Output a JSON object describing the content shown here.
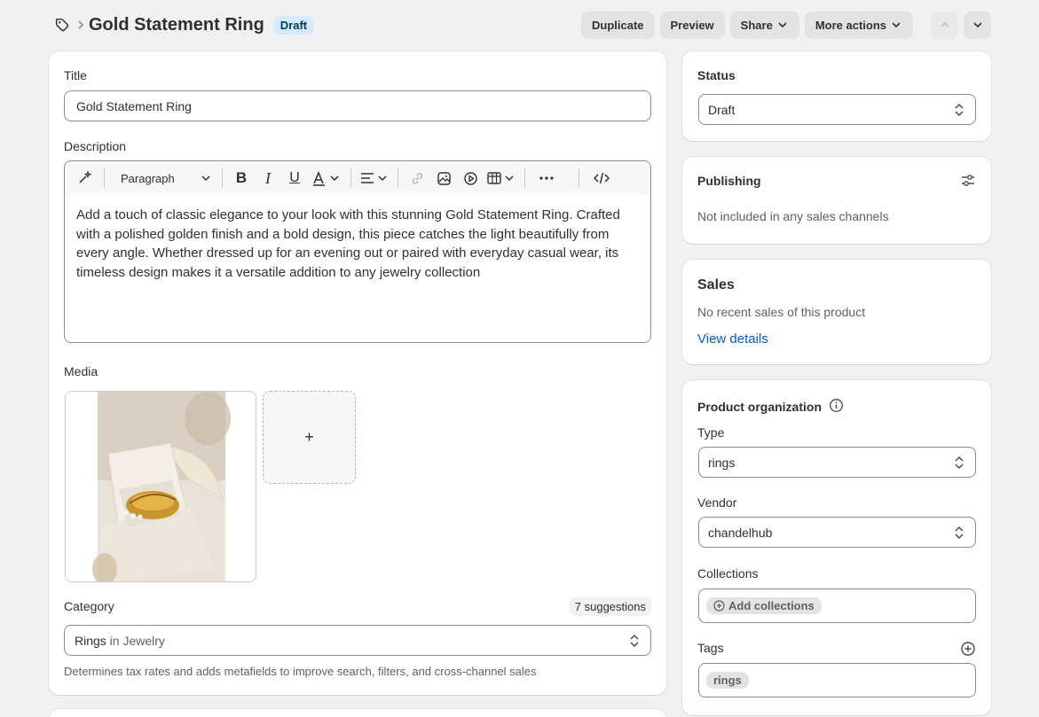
{
  "header": {
    "title": "Gold Statement Ring",
    "status_badge": "Draft",
    "actions": {
      "duplicate": "Duplicate",
      "preview": "Preview",
      "share": "Share",
      "more": "More actions"
    }
  },
  "main": {
    "title_label": "Title",
    "title_value": "Gold Statement Ring",
    "description_label": "Description",
    "toolbar_paragraph": "Paragraph",
    "description_text": "Add a touch of classic elegance to your look with this stunning Gold Statement Ring. Crafted with a polished golden finish and a bold design, this piece catches the light beautifully from every angle. Whether dressed up for an evening out or paired with everyday casual wear, its timeless design makes it a versatile addition to any jewelry collection",
    "media_label": "Media",
    "media_add": "+",
    "category_label": "Category",
    "category_suggestions": "7 suggestions",
    "category_value_strong": "Rings",
    "category_value_rest": " in Jewelry",
    "category_help": "Determines tax rates and adds metafields to improve search, filters, and cross-channel sales"
  },
  "sidebar": {
    "status": {
      "label": "Status",
      "value": "Draft"
    },
    "publishing": {
      "title": "Publishing",
      "text": "Not included in any sales channels"
    },
    "sales": {
      "title": "Sales",
      "text": "No recent sales of this product",
      "link": "View details"
    },
    "organization": {
      "title": "Product organization",
      "type_label": "Type",
      "type_value": "rings",
      "vendor_label": "Vendor",
      "vendor_value": "chandelhub",
      "collections_label": "Collections",
      "collections_button": "Add collections",
      "tags_label": "Tags",
      "tag_value": "rings"
    }
  },
  "icons": [
    "tag-icon",
    "chevron-right-icon",
    "chevron-down-icon",
    "chevron-up-icon",
    "magic-icon",
    "bold-icon",
    "italic-icon",
    "underline-icon",
    "text-color-icon",
    "align-icon",
    "link-icon",
    "image-icon",
    "video-icon",
    "table-icon",
    "more-icon",
    "code-icon",
    "select-arrows-icon",
    "sliders-icon",
    "info-icon",
    "plus-circle-icon"
  ],
  "colors": {
    "badge_bg": "#d5ebff",
    "link": "#005bd3",
    "page_bg": "#f1f1f1"
  }
}
